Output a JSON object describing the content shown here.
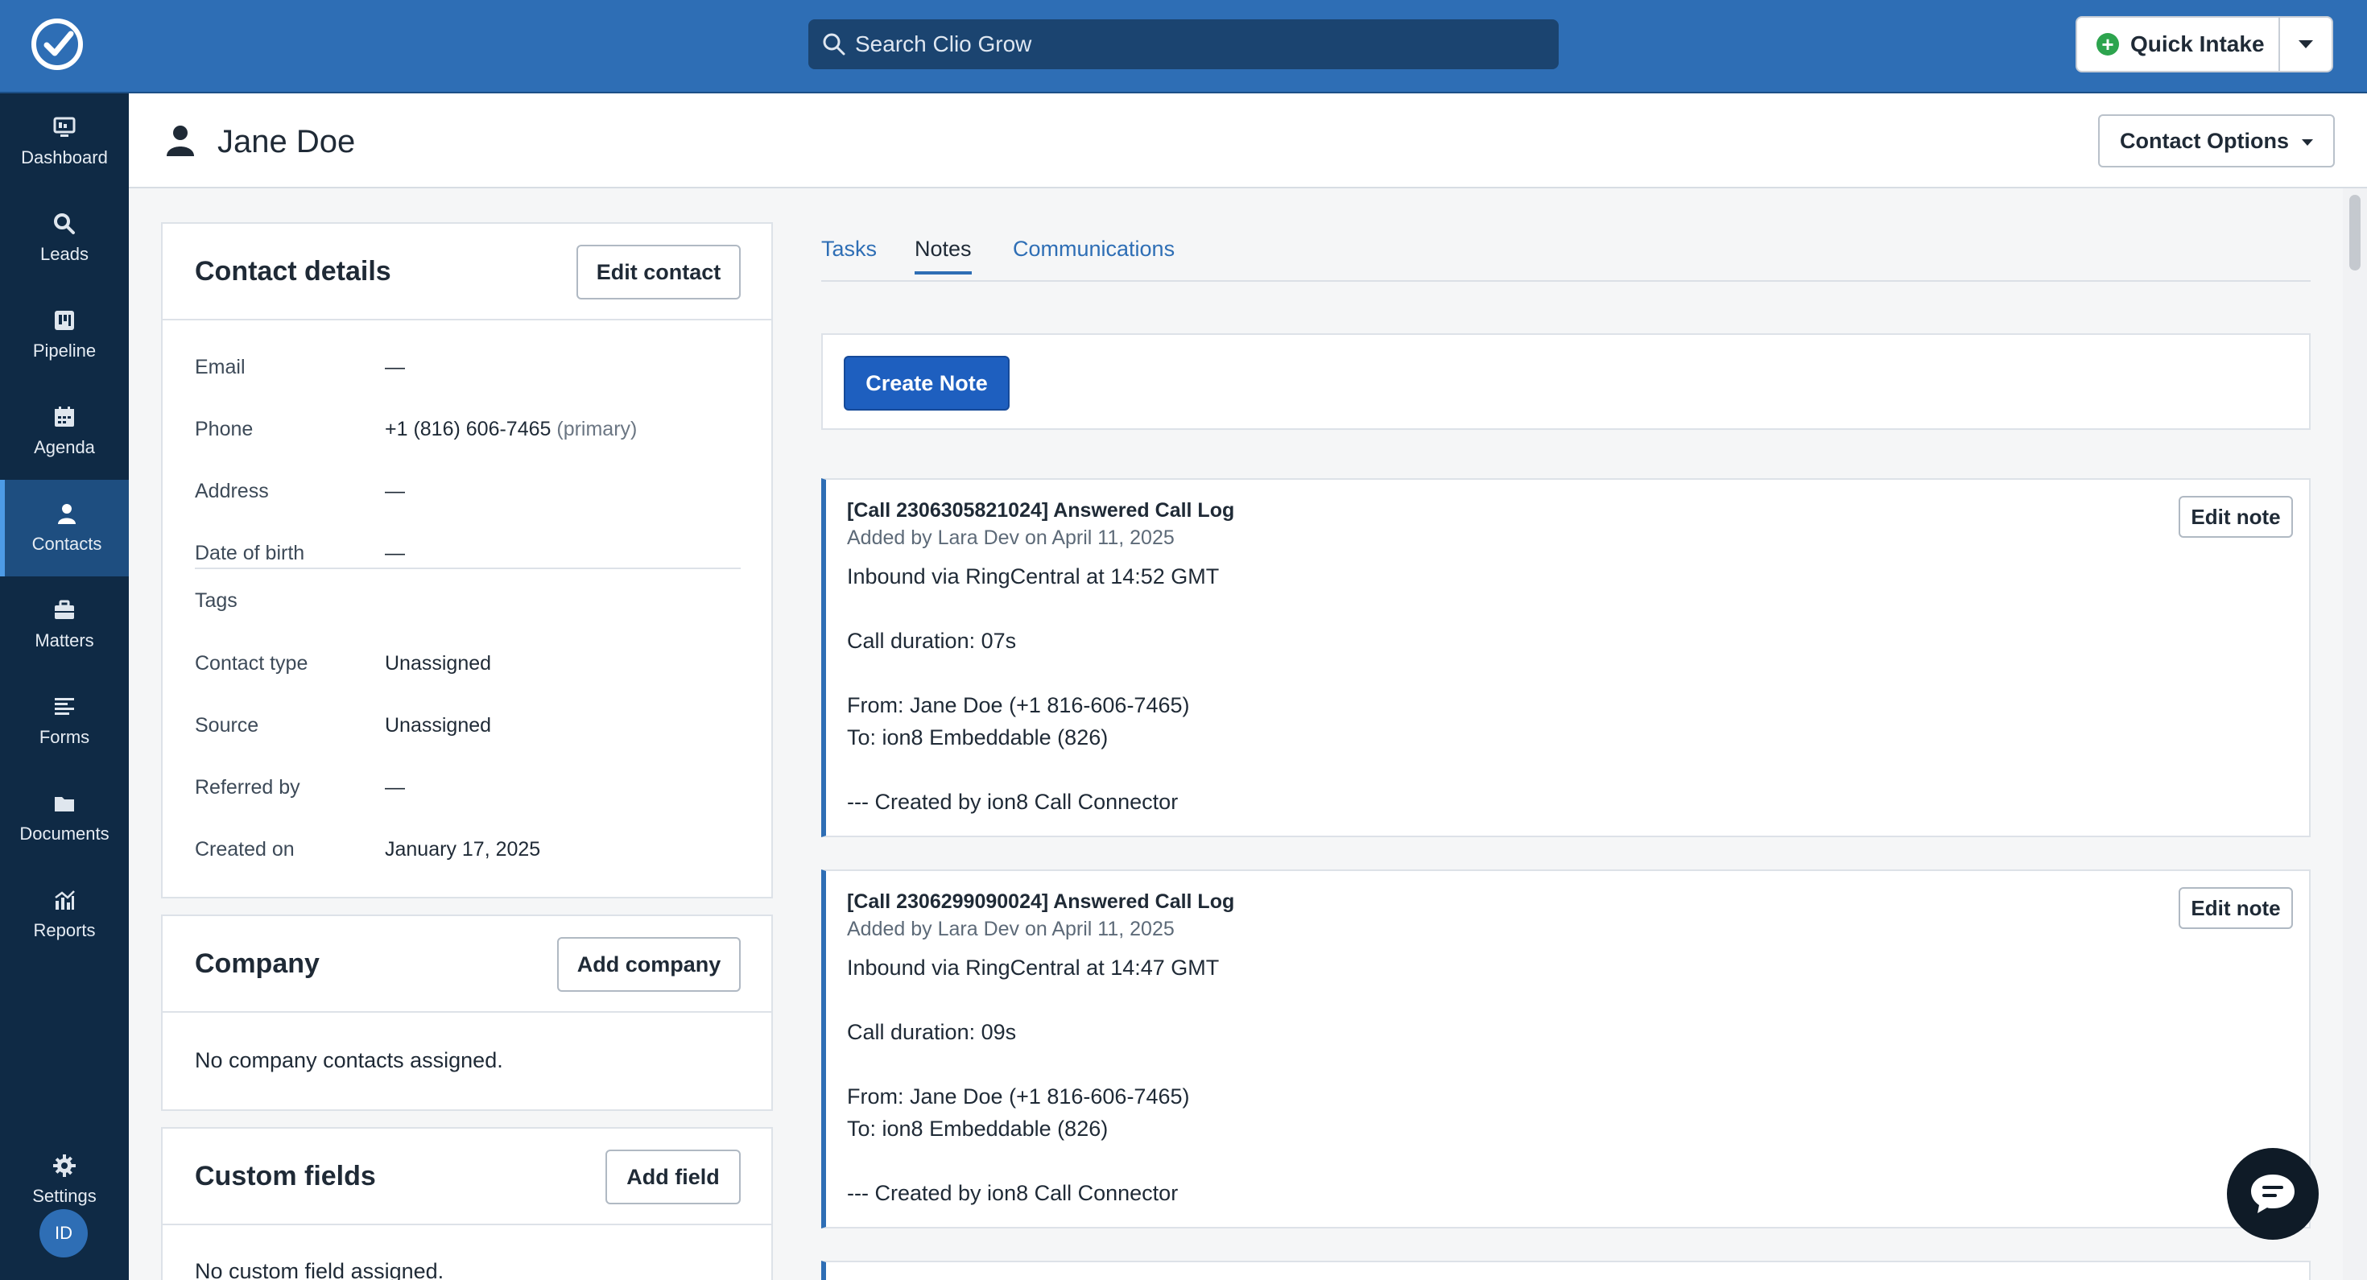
{
  "topbar": {
    "search_placeholder": "Search Clio Grow",
    "quick_intake_label": "Quick Intake"
  },
  "sidebar": {
    "items": [
      {
        "label": "Dashboard",
        "icon": "dashboard-icon"
      },
      {
        "label": "Leads",
        "icon": "search-icon"
      },
      {
        "label": "Pipeline",
        "icon": "pipeline-icon"
      },
      {
        "label": "Agenda",
        "icon": "calendar-icon"
      },
      {
        "label": "Contacts",
        "icon": "person-icon",
        "active": true
      },
      {
        "label": "Matters",
        "icon": "briefcase-icon"
      },
      {
        "label": "Forms",
        "icon": "forms-icon"
      },
      {
        "label": "Documents",
        "icon": "folder-icon"
      },
      {
        "label": "Reports",
        "icon": "chart-icon"
      }
    ],
    "settings_label": "Settings",
    "avatar_initials": "ID"
  },
  "header": {
    "contact_name": "Jane Doe",
    "contact_options_label": "Contact Options"
  },
  "contact_details": {
    "title": "Contact details",
    "edit_label": "Edit contact",
    "fields": {
      "email": {
        "label": "Email",
        "value": "—"
      },
      "phone": {
        "label": "Phone",
        "value": "+1 (816) 606-7465",
        "note": "(primary)"
      },
      "address": {
        "label": "Address",
        "value": "—"
      },
      "dob": {
        "label": "Date of birth",
        "value": "—"
      },
      "tags": {
        "label": "Tags",
        "value": ""
      },
      "contact_type": {
        "label": "Contact type",
        "value": "Unassigned"
      },
      "source": {
        "label": "Source",
        "value": "Unassigned"
      },
      "referred_by": {
        "label": "Referred by",
        "value": "—"
      },
      "created_on": {
        "label": "Created on",
        "value": "January 17, 2025"
      }
    }
  },
  "company": {
    "title": "Company",
    "add_label": "Add company",
    "empty_text": "No company contacts assigned."
  },
  "custom_fields": {
    "title": "Custom fields",
    "add_label": "Add field",
    "empty_text": "No custom field assigned."
  },
  "tabs": [
    "Tasks",
    "Notes",
    "Communications"
  ],
  "active_tab": "Notes",
  "create_note_label": "Create Note",
  "notes": [
    {
      "title": "[Call 2306305821024] Answered Call Log",
      "added_by": "Added by Lara Dev on April 11, 2025",
      "edit_label": "Edit note",
      "lines": [
        "Inbound via RingCentral at 14:52 GMT",
        "",
        "Call duration: 07s",
        "",
        "From: Jane Doe (+1 816-606-7465)",
        "To: ion8 Embeddable (826)",
        "",
        "--- Created by ion8 Call Connector"
      ]
    },
    {
      "title": "[Call 2306299090024] Answered Call Log",
      "added_by": "Added by Lara Dev on April 11, 2025",
      "edit_label": "Edit note",
      "lines": [
        "Inbound via RingCentral at 14:47 GMT",
        "",
        "Call duration: 09s",
        "",
        "From: Jane Doe (+1 816-606-7465)",
        "To: ion8 Embeddable (826)",
        "",
        "--- Created by ion8 Call Connector"
      ]
    }
  ],
  "colors": {
    "topbar": "#2e6eb5",
    "sidebar": "#0f2a45",
    "sidebar_active": "#1e4e80",
    "primary_button": "#1e5fbf"
  }
}
